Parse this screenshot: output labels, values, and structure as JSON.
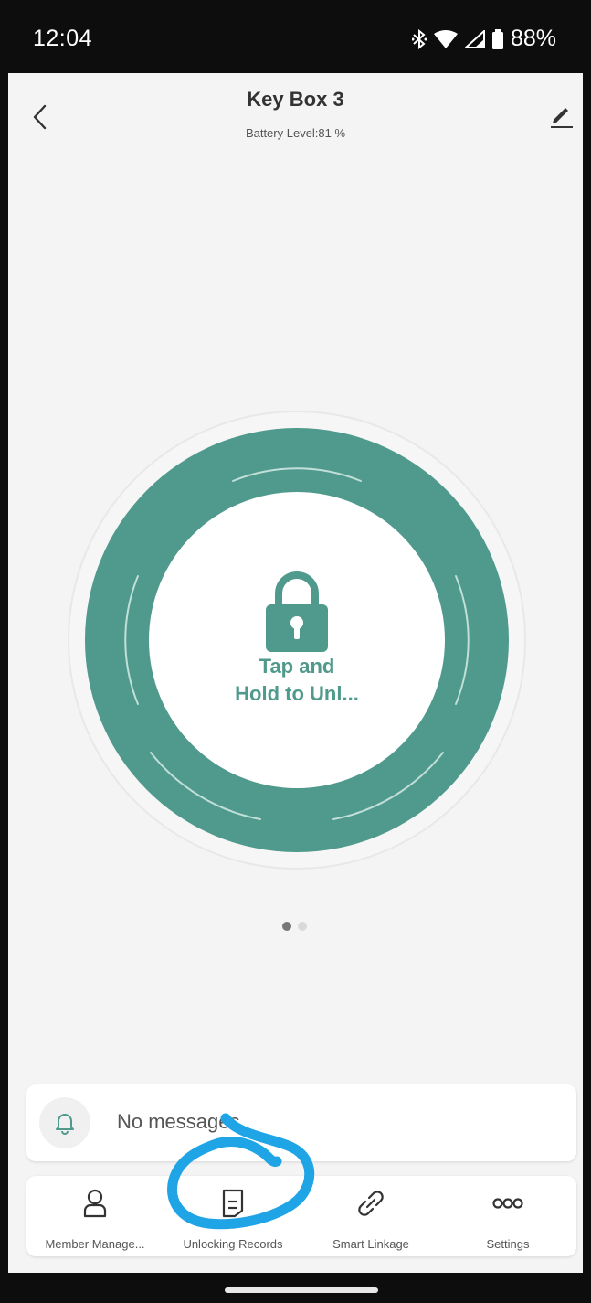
{
  "status_bar": {
    "time": "12:04",
    "battery": "88%"
  },
  "header": {
    "title": "Key Box 3",
    "battery_level": "Battery Level:81 %"
  },
  "unlock": {
    "line1": "Tap and",
    "line2": "Hold to Unl..."
  },
  "pager": {
    "active_page": 1,
    "total_pages": 2
  },
  "messages": {
    "text": "No messages."
  },
  "tabs": [
    {
      "label": "Member Manage...",
      "icon": "person-icon"
    },
    {
      "label": "Unlocking Records",
      "icon": "document-icon"
    },
    {
      "label": "Smart Linkage",
      "icon": "link-icon"
    },
    {
      "label": "Settings",
      "icon": "more-icon"
    }
  ],
  "colors": {
    "accent": "#4f9a8c",
    "background": "#f4f4f4",
    "annotation": "#1fa4e6"
  }
}
